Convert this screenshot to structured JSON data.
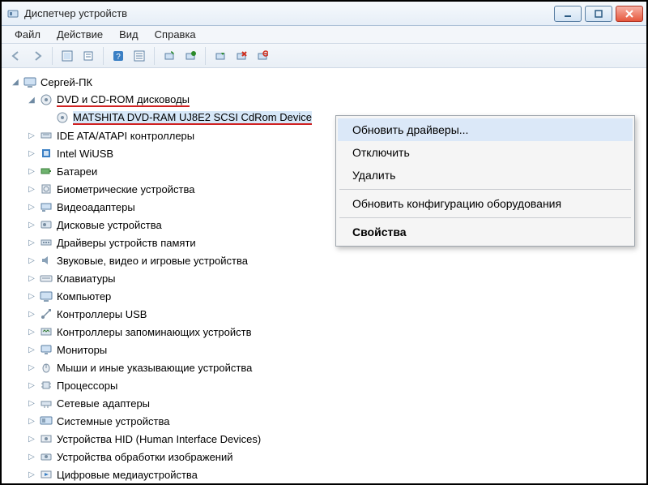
{
  "window": {
    "title": "Диспетчер устройств"
  },
  "menu": {
    "file": "Файл",
    "action": "Действие",
    "view": "Вид",
    "help": "Справка"
  },
  "tree": {
    "root": "Сергей-ПК",
    "dvd_category": "DVD и CD-ROM дисководы",
    "dvd_device": "MATSHITA DVD-RAM UJ8E2 SCSI CdRom Device",
    "categories": {
      "ide": "IDE ATA/ATAPI контроллеры",
      "wiusb": "Intel WiUSB",
      "batteries": "Батареи",
      "biometric": "Биометрические устройства",
      "video": "Видеоадаптеры",
      "disk": "Дисковые устройства",
      "memdrv": "Драйверы устройств памяти",
      "sound": "Звуковые, видео и игровые устройства",
      "keyboards": "Клавиатуры",
      "computer": "Компьютер",
      "usb": "Контроллеры USB",
      "storage_ctrl": "Контроллеры запоминающих устройств",
      "monitors": "Мониторы",
      "mice": "Мыши и иные указывающие устройства",
      "cpu": "Процессоры",
      "net": "Сетевые адаптеры",
      "system": "Системные устройства",
      "hid": "Устройства HID (Human Interface Devices)",
      "imaging": "Устройства обработки изображений",
      "digital_media": "Цифровые медиаустройства"
    }
  },
  "context_menu": {
    "update": "Обновить драйверы...",
    "disable": "Отключить",
    "uninstall": "Удалить",
    "scan": "Обновить конфигурацию оборудования",
    "properties": "Свойства"
  }
}
